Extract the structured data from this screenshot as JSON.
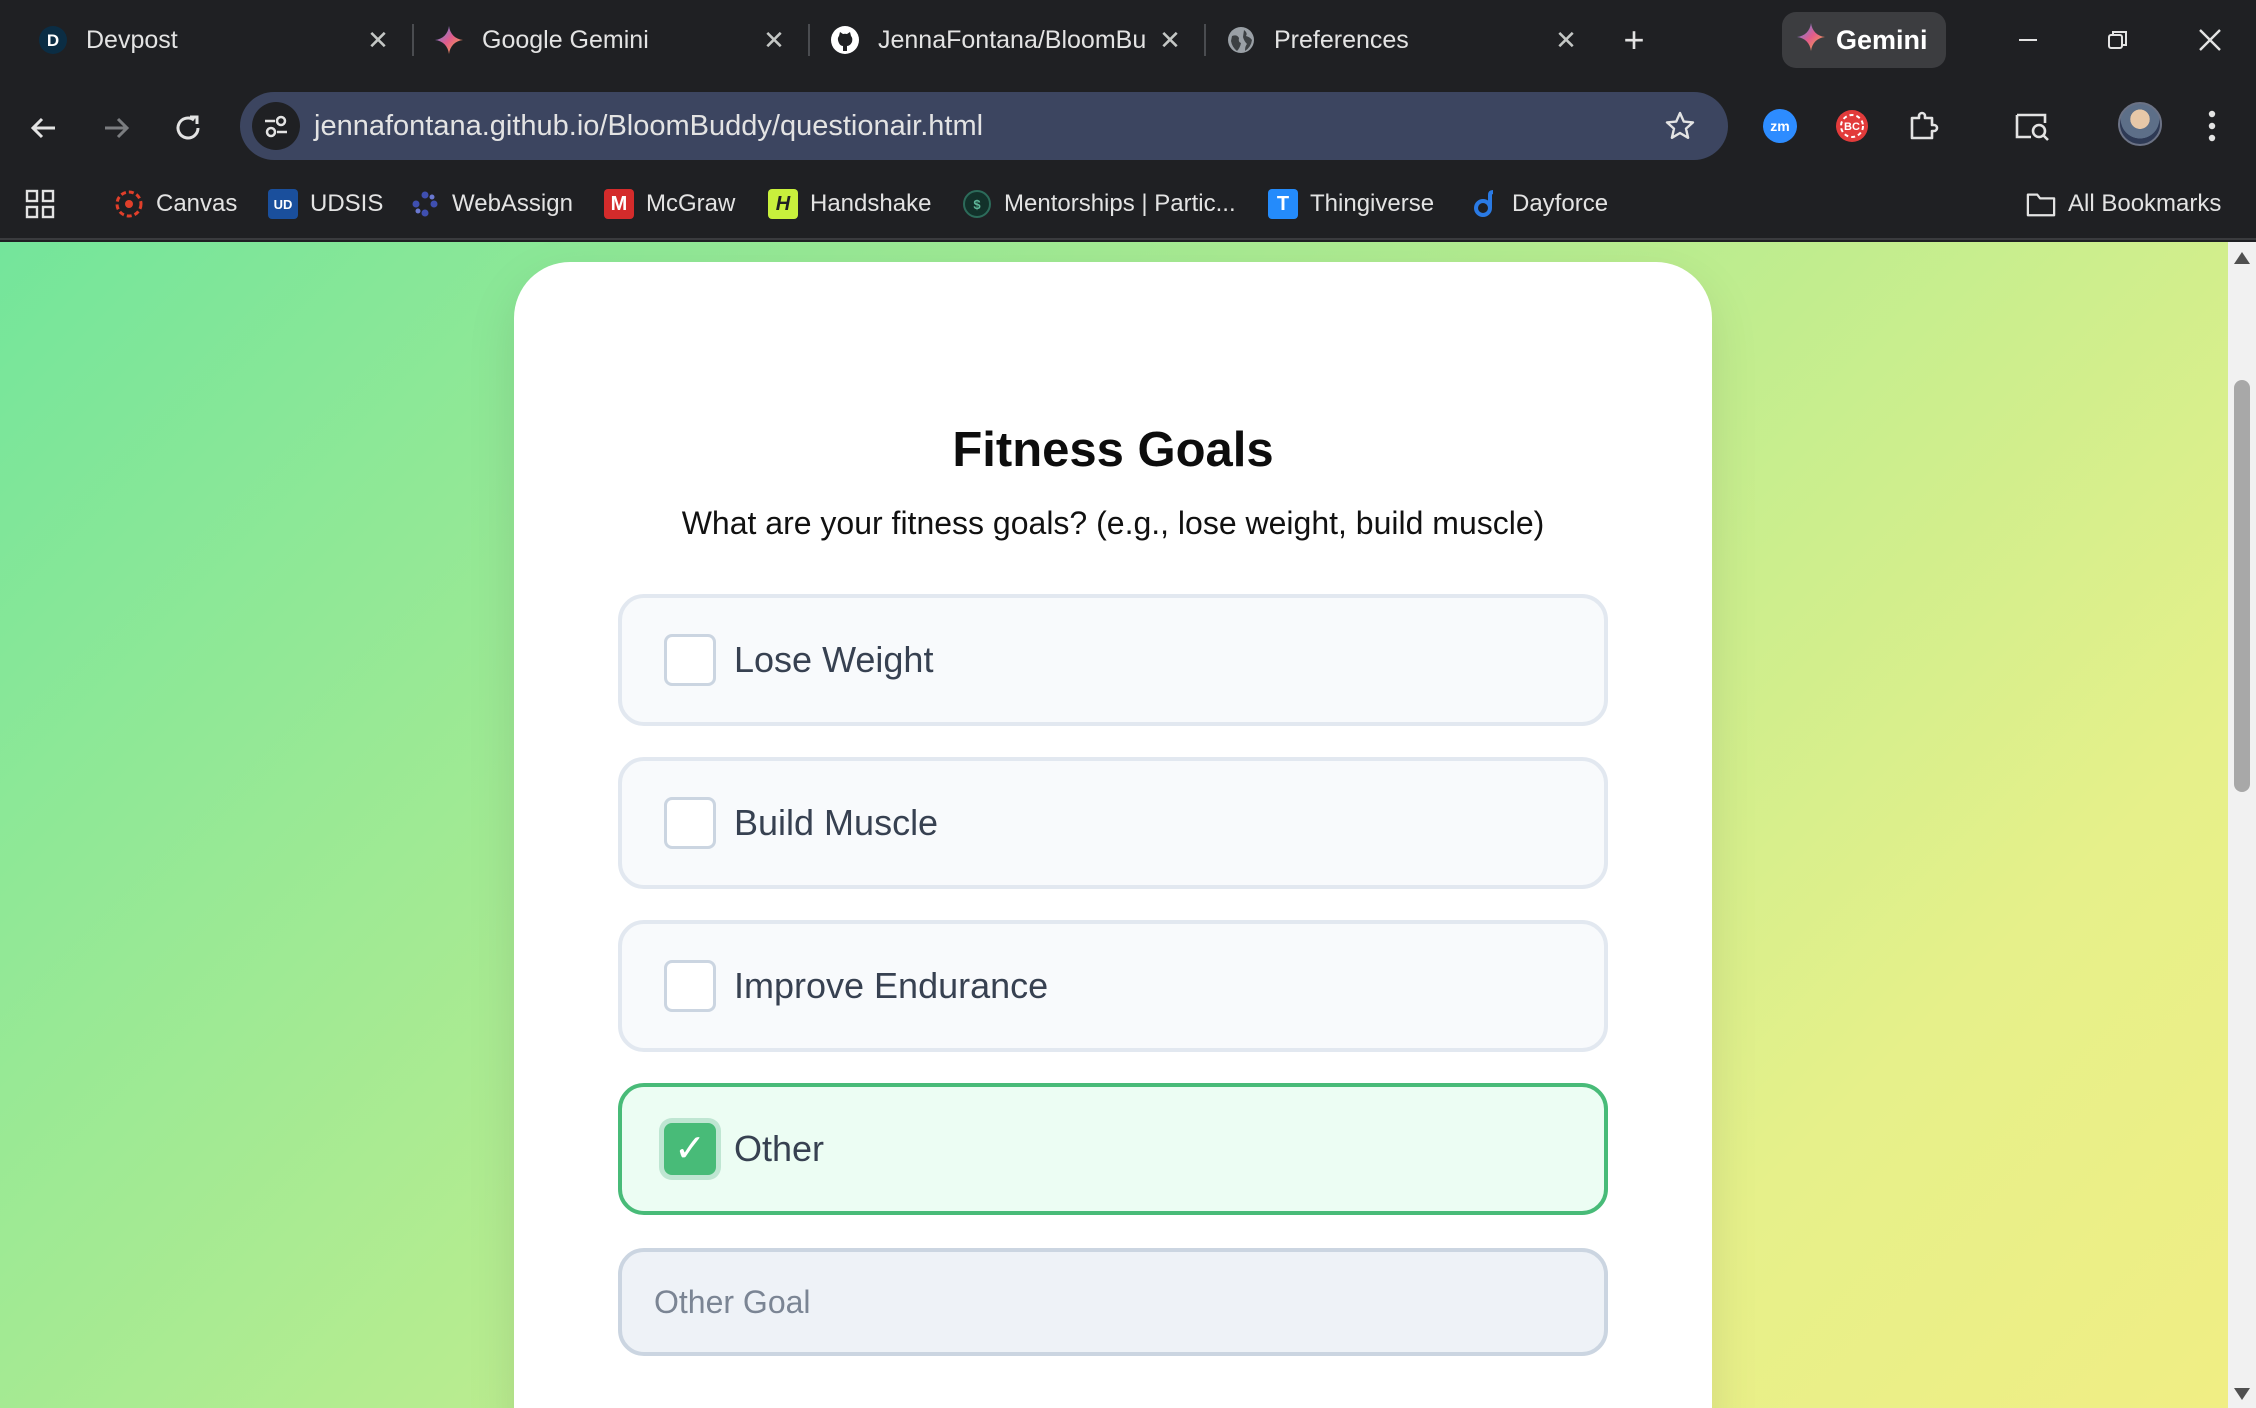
{
  "tabs": [
    {
      "title": "Devpost",
      "icon": "devpost-icon",
      "icon_char": "D"
    },
    {
      "title": "Google Gemini",
      "icon": "gemini-sparkle-icon"
    },
    {
      "title": "JennaFontana/BloomBu",
      "icon": "github-icon"
    },
    {
      "title": "Preferences",
      "icon": "globe-icon"
    }
  ],
  "gemini_button": {
    "label": "Gemini"
  },
  "address_bar": {
    "url": "jennafontana.github.io/BloomBuddy/questionair.html"
  },
  "bookmarks": [
    {
      "label": "Canvas",
      "icon": "canvas-icon"
    },
    {
      "label": "UDSIS",
      "icon": "udsis-icon",
      "icon_char": "UD"
    },
    {
      "label": "WebAssign",
      "icon": "webassign-icon"
    },
    {
      "label": "McGraw",
      "icon": "mcgraw-icon",
      "icon_char": "M"
    },
    {
      "label": "Handshake",
      "icon": "handshake-icon",
      "icon_char": "H"
    },
    {
      "label": "Mentorships | Partic...",
      "icon": "mentorships-icon"
    },
    {
      "label": "Thingiverse",
      "icon": "thingiverse-icon",
      "icon_char": "T"
    },
    {
      "label": "Dayforce",
      "icon": "dayforce-icon"
    }
  ],
  "all_bookmarks": {
    "label": "All Bookmarks"
  },
  "page": {
    "title": "Fitness Goals",
    "question": "What are your fitness goals? (e.g., lose weight, build muscle)",
    "options": [
      {
        "label": "Lose Weight",
        "checked": false
      },
      {
        "label": "Build Muscle",
        "checked": false
      },
      {
        "label": "Improve Endurance",
        "checked": false
      },
      {
        "label": "Other",
        "checked": true,
        "check_mark": "✓"
      }
    ],
    "other_input": {
      "placeholder": "Other Goal",
      "value": ""
    }
  },
  "colors": {
    "accent_green": "#48bb78",
    "gradient_start": "#74e59b",
    "gradient_end": "#f0ee84",
    "omnibox": "#3c4560",
    "chrome_dark": "#1f2023"
  }
}
